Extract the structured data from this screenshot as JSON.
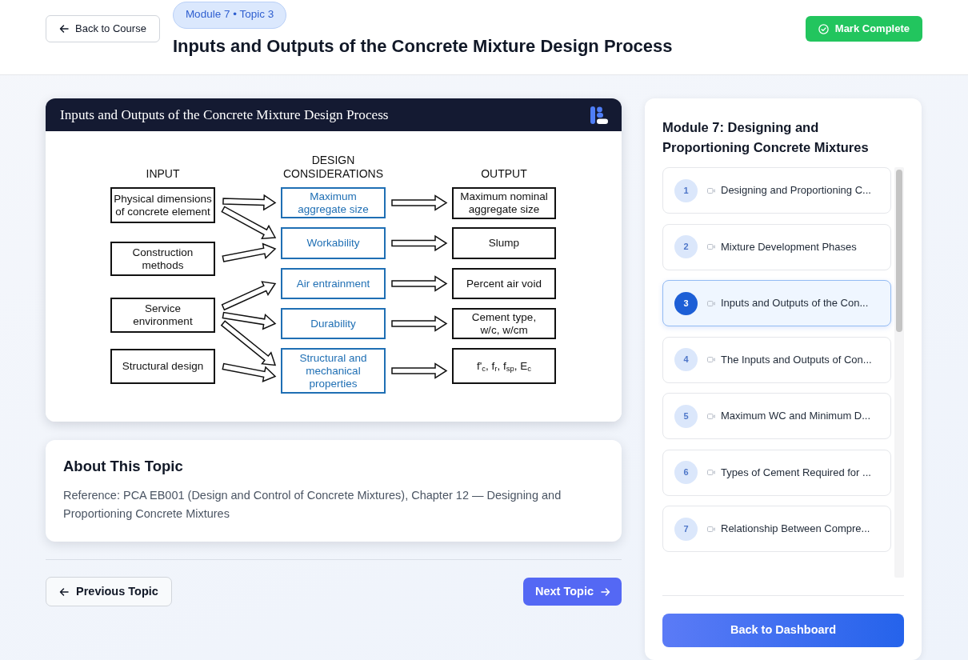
{
  "header": {
    "back_button": "Back to Course",
    "badge": "Module 7 • Topic 3",
    "title": "Inputs and Outputs of the Concrete Mixture Design Process",
    "complete_button": "Mark Complete"
  },
  "slide": {
    "title": "Inputs and Outputs of the Concrete Mixture Design Process",
    "diagram": {
      "inputs": {
        "heading": [
          "INPUT"
        ],
        "nodes": [
          {
            "lines": [
              "Physical dimensions",
              "of concrete element"
            ],
            "leads_to": [
              true,
              true,
              false,
              false,
              false
            ]
          },
          {
            "lines": [
              "Construction",
              "methods"
            ],
            "leads_to": [
              false,
              true,
              false,
              false,
              false
            ]
          },
          {
            "lines": [
              "Service",
              "environment"
            ],
            "leads_to": [
              false,
              false,
              true,
              true,
              true
            ]
          },
          {
            "lines": [
              "Structural design"
            ],
            "leads_to": [
              false,
              false,
              false,
              false,
              true
            ]
          }
        ]
      },
      "considerations": {
        "heading": [
          "DESIGN",
          "CONSIDERATIONS"
        ],
        "nodes": [
          {
            "lines": [
              "Maximum",
              "aggregate size"
            ],
            "leads_to": [
              true,
              false,
              false,
              false,
              false
            ]
          },
          {
            "lines": [
              "Workability"
            ],
            "leads_to": [
              false,
              true,
              false,
              false,
              false
            ]
          },
          {
            "lines": [
              "Air entrainment"
            ],
            "leads_to": [
              false,
              false,
              true,
              false,
              false
            ]
          },
          {
            "lines": [
              "Durability"
            ],
            "leads_to": [
              false,
              false,
              false,
              true,
              false
            ]
          },
          {
            "lines": [
              "Structural and",
              "mechanical",
              "properties"
            ],
            "leads_to": [
              false,
              false,
              false,
              false,
              true
            ]
          }
        ]
      },
      "outputs": {
        "heading": [
          "OUTPUT"
        ],
        "nodes": [
          {
            "lines": [
              "Maximum nominal",
              "aggregate size"
            ]
          },
          {
            "lines": [
              "Slump"
            ]
          },
          {
            "lines": [
              "Percent air void"
            ]
          },
          {
            "lines": [
              "Cement type,",
              "w/c, w/cm"
            ]
          },
          {
            "lines": [
              "f'$_{c}$, f$_{r}$, f$_{sp}$, E$_{c}$"
            ]
          }
        ]
      }
    }
  },
  "about": {
    "heading": "About This Topic",
    "text": "Reference: PCA EB001 (Design and Control of Concrete Mixtures), Chapter 12 — Designing and Proportioning Concrete Mixtures"
  },
  "navigation": {
    "previous": "Previous Topic",
    "next": "Next Topic"
  },
  "sidebar": {
    "title": "Module 7: Designing and Proportioning Concrete Mixtures",
    "topics": [
      {
        "number": "1",
        "title": "Designing and Proportioning C...",
        "selected": false
      },
      {
        "number": "2",
        "title": "Mixture Development Phases",
        "selected": false
      },
      {
        "number": "3",
        "title": "Inputs and Outputs of the Con...",
        "selected": true
      },
      {
        "number": "4",
        "title": "The Inputs and Outputs of Con...",
        "selected": false
      },
      {
        "number": "5",
        "title": "Maximum WC and Minimum D...",
        "selected": false
      },
      {
        "number": "6",
        "title": "Types of Cement Required for ...",
        "selected": false
      },
      {
        "number": "7",
        "title": "Relationship Between Compre...",
        "selected": false
      }
    ],
    "dashboard_button": "Back to Dashboard"
  }
}
